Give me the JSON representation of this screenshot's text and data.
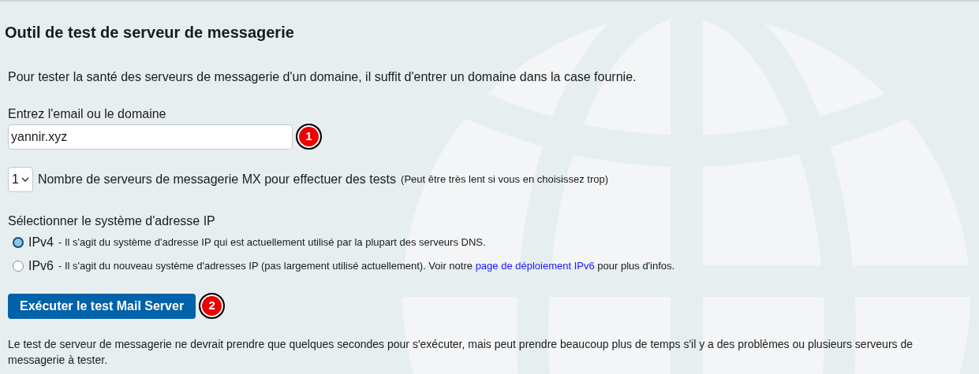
{
  "title": "Outil de test de serveur de messagerie",
  "intro": "Pour tester la santé des serveurs de messagerie d'un domaine, il suffit d'entrer un domaine dans la case fournie.",
  "domain_field": {
    "label": "Entrez l'email ou le domaine",
    "value": "yannir.xyz",
    "badge": "1"
  },
  "mx_count": {
    "value": "1",
    "label": "Nombre de serveurs de messagerie MX pour effectuer des tests",
    "note": "(Peut être très lent si vous en choisissez trop)"
  },
  "ip_system": {
    "label": "Sélectionner le système d'adresse IP",
    "options": [
      {
        "name": "IPv4",
        "description": "- Il s'agit du système d'adresse IP qui est actuellement utilisé par la plupart des serveurs DNS.",
        "selected": true
      },
      {
        "name": "IPv6",
        "description": "- Il s'agit du nouveau système d'adresses IP (pas largement utilisé actuellement). Voir notre ",
        "link": "page de déploiement IPv6",
        "suffix": " pour plus d'infos.",
        "selected": false
      }
    ]
  },
  "run_button": {
    "label": "Exécuter le test Mail Server",
    "badge": "2"
  },
  "footer": "Le test de serveur de messagerie ne devrait prendre que quelques secondes pour s'exécuter, mais peut prendre beaucoup plus de temps s'il y a des problèmes ou plusieurs serveurs de messagerie à tester."
}
